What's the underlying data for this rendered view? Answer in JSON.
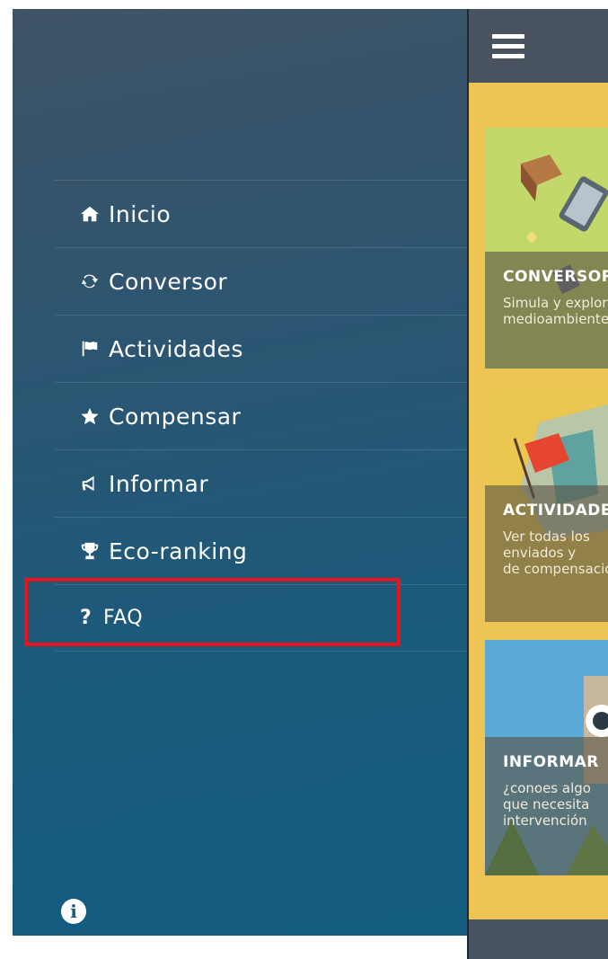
{
  "menu": {
    "items": [
      {
        "label": "Inicio",
        "icon": "home-icon"
      },
      {
        "label": "Conversor",
        "icon": "refresh-icon"
      },
      {
        "label": "Actividades",
        "icon": "flag-icon"
      },
      {
        "label": "Compensar",
        "icon": "star-icon"
      },
      {
        "label": "Informar",
        "icon": "megaphone-icon"
      },
      {
        "label": "Eco-ranking",
        "icon": "trophy-icon"
      },
      {
        "label": "FAQ",
        "icon": "question-icon",
        "icon_glyph": "?"
      }
    ],
    "info_icon": "info-icon",
    "info_glyph": "i"
  },
  "header": {
    "menu_icon": "hamburger-icon"
  },
  "cards": [
    {
      "title": "CONVERSOR",
      "description_lines": [
        "Simula y explora",
        "medioambiente"
      ]
    },
    {
      "title": "ACTIVIDADES",
      "description_lines": [
        "Ver todas los",
        "enviados y",
        "de compensación"
      ]
    },
    {
      "title": "INFORMAR",
      "description_lines": [
        "¿conoes algo",
        "que necesita",
        "intervención"
      ]
    }
  ],
  "colors": {
    "sidebar_top": "#3f5466",
    "sidebar_bottom": "#125c80",
    "highlight": "#e8141b",
    "topbar": "#48535f",
    "content_bg": "#eec455"
  }
}
